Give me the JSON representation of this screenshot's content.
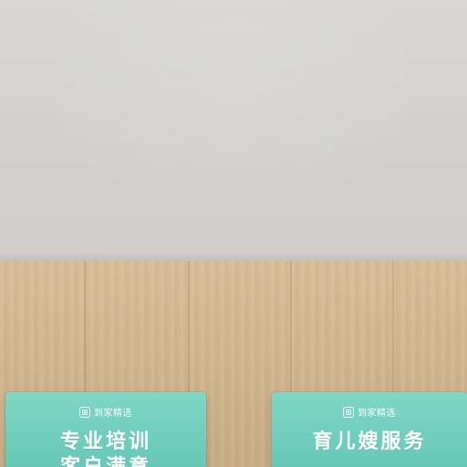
{
  "scene": {
    "card_left": {
      "brand": "到家精选",
      "line1": "专业培训",
      "line2": "客户满意"
    },
    "card_right": {
      "brand": "到家精选",
      "line1": "育儿嫂服务"
    },
    "colors": {
      "wall": "#d6d5d3",
      "floor": "#d3b990",
      "card": "#6ccbb8"
    }
  }
}
